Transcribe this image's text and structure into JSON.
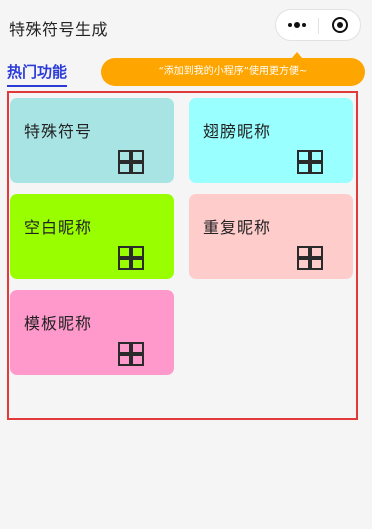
{
  "app": {
    "title": "特殊符号生成"
  },
  "capsule": {
    "more_icon": "more-dots-icon",
    "close_icon": "target-close-icon"
  },
  "section": {
    "tab_label": "热门功能"
  },
  "tip": {
    "text": "“添加到我的小程序”使用更方便~",
    "color": "#ffa500"
  },
  "frame": {
    "color": "#e23a3a"
  },
  "cards": [
    {
      "label": "特殊符号",
      "color": "#a9e4e4",
      "icon": "grid-icon"
    },
    {
      "label": "翅膀昵称",
      "color": "#99ffff",
      "icon": "grid-icon"
    },
    {
      "label": "空白昵称",
      "color": "#99ff00",
      "icon": "grid-icon"
    },
    {
      "label": "重复昵称",
      "color": "#ffcccc",
      "icon": "grid-icon"
    },
    {
      "label": "模板昵称",
      "color": "#ff99cc",
      "icon": "grid-icon"
    }
  ]
}
